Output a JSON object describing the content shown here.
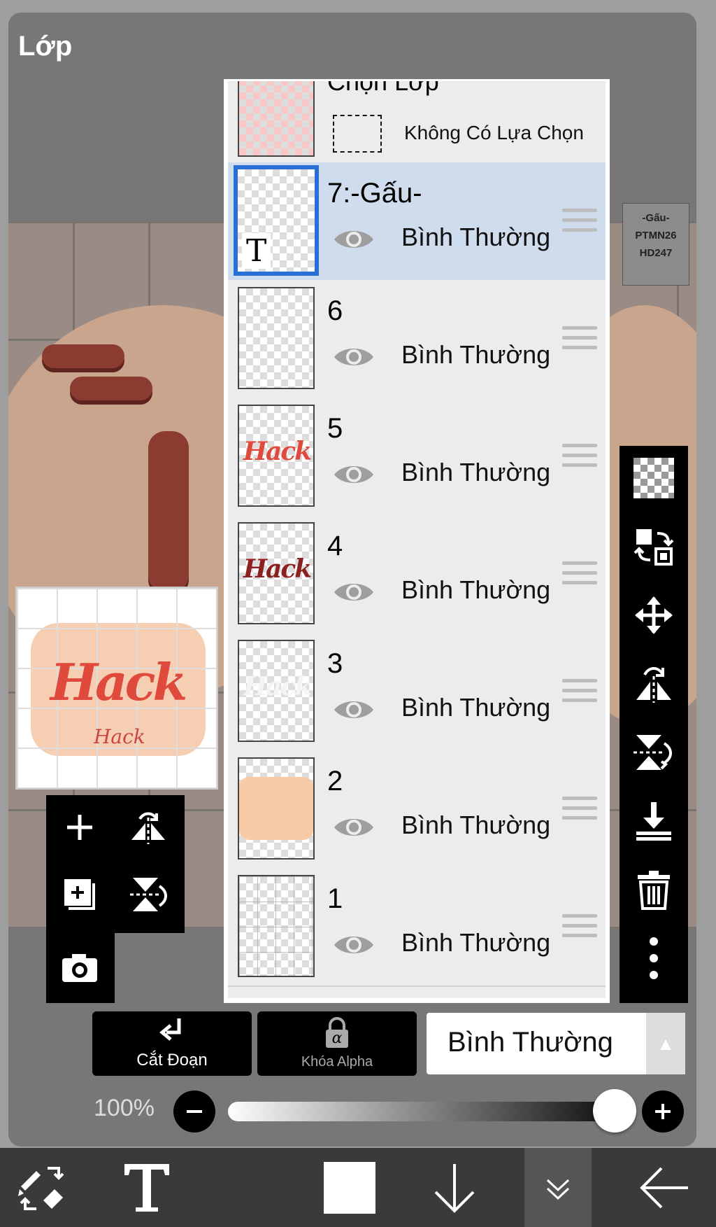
{
  "panel": {
    "title": "Lớp"
  },
  "stamp": {
    "lines": [
      "-Gấu-",
      "PTMN26",
      "HD247"
    ]
  },
  "preview": {
    "hack_text": "Hack",
    "sub_text": "Hack"
  },
  "selection_row": {
    "title": "Chọn Lớp",
    "label": "Không Có Lựa Chọn"
  },
  "layers": [
    {
      "name": "7:-Gấu-",
      "blend": "Bình Thường",
      "selected": true
    },
    {
      "name": "6",
      "blend": "Bình Thường",
      "selected": false
    },
    {
      "name": "5",
      "blend": "Bình Thường",
      "selected": false
    },
    {
      "name": "4",
      "blend": "Bình Thường",
      "selected": false
    },
    {
      "name": "3",
      "blend": "Bình Thường",
      "selected": false
    },
    {
      "name": "2",
      "blend": "Bình Thường",
      "selected": false
    },
    {
      "name": "1",
      "blend": "Bình Thường",
      "selected": false
    }
  ],
  "thumb_text": {
    "t": "T",
    "hack": "Hack"
  },
  "controls": {
    "clip_label": "Cắt Đoạn",
    "alpha_label": "Khóa Alpha",
    "alpha_symbol": "α",
    "blend_mode": "Bình Thường",
    "opacity": "100%",
    "opacity_value": 100
  },
  "colors": {
    "selected_row": "#cfdcee",
    "selected_border": "#2a6fd6",
    "hack_red": "#e04a3c",
    "hack_dark": "#8c1f1f"
  }
}
